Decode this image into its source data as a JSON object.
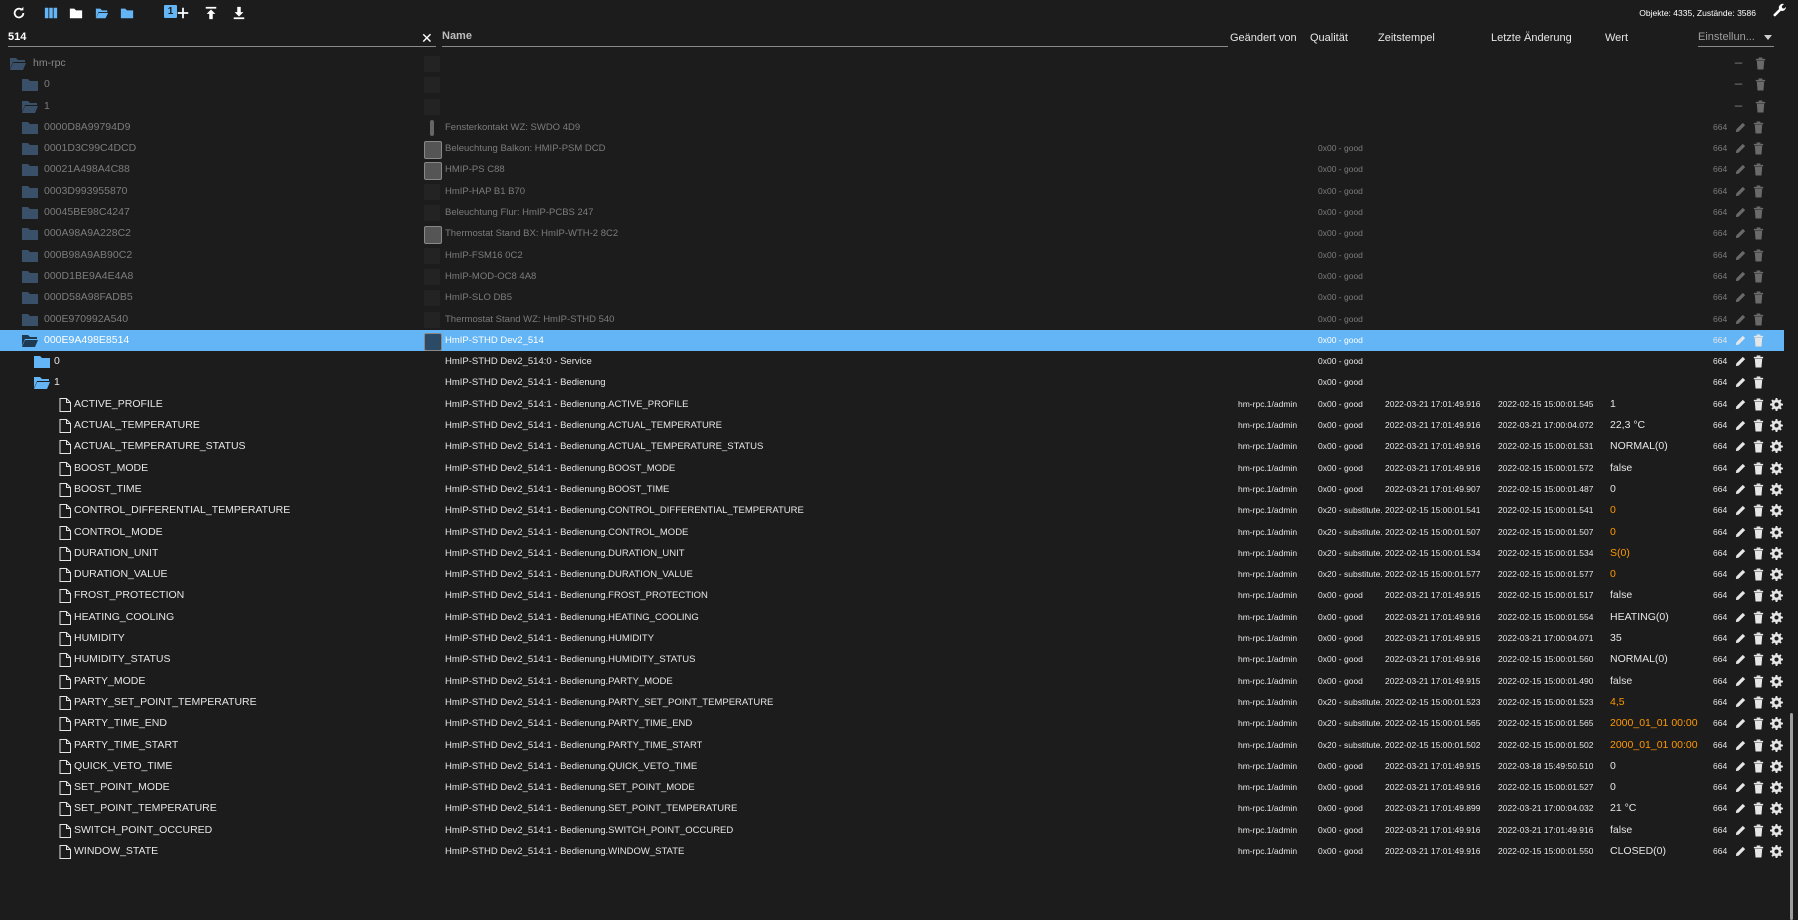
{
  "toolbar": {
    "stats": "Objekte: 4335, Zustände: 3586",
    "num_badge": "1",
    "buttons": [
      "refresh-icon",
      "columns-icon",
      "folder-icon",
      "folder-open-icon",
      "folder-closed-icon",
      "number-badge",
      "add-icon",
      "upload-icon",
      "download-icon"
    ]
  },
  "filter": {
    "id_value": "514",
    "name_placeholder": "Name"
  },
  "columns": {
    "changed_by": "Geändert von",
    "quality": "Qualität",
    "timestamp": "Zeitstempel",
    "last_change": "Letzte Änderung",
    "value": "Wert",
    "settings": "Einstellun..."
  },
  "colors": {
    "accent": "#64b5f6",
    "orange": "#ff9800",
    "bg": "#1c1c1c"
  },
  "rows": [
    {
      "id": "hm-rpc",
      "name": "",
      "ack": "",
      "quality": "",
      "ts": "",
      "lc": "",
      "value": "",
      "role": "",
      "level": 0,
      "type": "folder-open",
      "style": "dim2",
      "actions": "minus-trash"
    },
    {
      "id": "0",
      "name": "",
      "ack": "",
      "quality": "",
      "ts": "",
      "lc": "",
      "value": "",
      "role": "",
      "level": 1,
      "type": "folder",
      "style": "dim",
      "actions": "minus-trash"
    },
    {
      "id": "1",
      "name": "",
      "ack": "",
      "quality": "",
      "ts": "",
      "lc": "",
      "value": "",
      "role": "",
      "level": 1,
      "type": "folder-open",
      "style": "dim",
      "actions": "minus-trash"
    },
    {
      "id": "0000D8A99794D9",
      "name": "Fensterkontakt WZ: SWDO 4D9",
      "ack": "",
      "quality": "",
      "ts": "",
      "lc": "",
      "value": "",
      "role": "664",
      "level": 2,
      "type": "folder",
      "style": "dim",
      "actions": "edit-trash",
      "icon": "bar"
    },
    {
      "id": "0001D3C99C4DCD",
      "name": "Beleuchtung Balkon: HMIP-PSM DCD",
      "ack": "",
      "quality": "0x00 - good",
      "ts": "",
      "lc": "",
      "value": "",
      "role": "664",
      "level": 2,
      "type": "folder",
      "style": "dim",
      "actions": "edit-trash",
      "icon": "device"
    },
    {
      "id": "00021A498A4C88",
      "name": "HMIP-PS C88",
      "ack": "",
      "quality": "0x00 - good",
      "ts": "",
      "lc": "",
      "value": "",
      "role": "664",
      "level": 2,
      "type": "folder",
      "style": "dim",
      "actions": "edit-trash",
      "icon": "device"
    },
    {
      "id": "0003D993955870",
      "name": "HmIP-HAP B1 B70",
      "ack": "",
      "quality": "0x00 - good",
      "ts": "",
      "lc": "",
      "value": "",
      "role": "664",
      "level": 2,
      "type": "folder",
      "style": "dim",
      "actions": "edit-trash",
      "icon": ""
    },
    {
      "id": "00045BE98C4247",
      "name": "Beleuchtung Flur: HmIP-PCBS 247",
      "ack": "",
      "quality": "0x00 - good",
      "ts": "",
      "lc": "",
      "value": "",
      "role": "664",
      "level": 2,
      "type": "folder",
      "style": "dim",
      "actions": "edit-trash",
      "icon": ""
    },
    {
      "id": "000A98A9A228C2",
      "name": "Thermostat Stand BX: HmIP-WTH-2 8C2",
      "ack": "",
      "quality": "0x00 - good",
      "ts": "",
      "lc": "",
      "value": "",
      "role": "664",
      "level": 2,
      "type": "folder",
      "style": "dim",
      "actions": "edit-trash",
      "icon": "device"
    },
    {
      "id": "000B98A9AB90C2",
      "name": "HmIP-FSM16 0C2",
      "ack": "",
      "quality": "0x00 - good",
      "ts": "",
      "lc": "",
      "value": "",
      "role": "664",
      "level": 2,
      "type": "folder",
      "style": "dim",
      "actions": "edit-trash",
      "icon": ""
    },
    {
      "id": "000D1BE9A4E4A8",
      "name": "HmIP-MOD-OC8 4A8",
      "ack": "",
      "quality": "0x00 - good",
      "ts": "",
      "lc": "",
      "value": "",
      "role": "664",
      "level": 2,
      "type": "folder",
      "style": "dim",
      "actions": "edit-trash",
      "icon": ""
    },
    {
      "id": "000D58A98FADB5",
      "name": "HmIP-SLO DB5",
      "ack": "",
      "quality": "0x00 - good",
      "ts": "",
      "lc": "",
      "value": "",
      "role": "664",
      "level": 2,
      "type": "folder",
      "style": "dim",
      "actions": "edit-trash",
      "icon": ""
    },
    {
      "id": "000E970992A540",
      "name": "Thermostat Stand WZ: HmIP-STHD 540",
      "ack": "",
      "quality": "0x00 - good",
      "ts": "",
      "lc": "",
      "value": "",
      "role": "664",
      "level": 2,
      "type": "folder",
      "style": "dim",
      "actions": "edit-trash",
      "icon": ""
    },
    {
      "id": "000E9A498E8514",
      "name": "HmIP-STHD Dev2_514",
      "ack": "",
      "quality": "0x00 - good",
      "ts": "",
      "lc": "",
      "value": "",
      "role": "664",
      "level": 2,
      "type": "folder-open",
      "style": "sel",
      "actions": "edit-trash",
      "icon": "device"
    },
    {
      "id": "0",
      "name": "HmIP-STHD Dev2_514:0 - Service",
      "ack": "",
      "quality": "0x00 - good",
      "ts": "",
      "lc": "",
      "value": "",
      "role": "664",
      "level": 3,
      "type": "folder",
      "style": "",
      "actions": "edit-trash"
    },
    {
      "id": "1",
      "name": "HmIP-STHD Dev2_514:1 - Bedienung",
      "ack": "",
      "quality": "0x00 - good",
      "ts": "",
      "lc": "",
      "value": "",
      "role": "664",
      "level": 3,
      "type": "folder-open",
      "style": "",
      "actions": "edit-trash"
    },
    {
      "id": "ACTIVE_PROFILE",
      "name": "HmIP-STHD Dev2_514:1 - Bedienung.ACTIVE_PROFILE",
      "ack": "hm-rpc.1/admin",
      "quality": "0x00 - good",
      "ts": "2022-03-21 17:01:49.916",
      "lc": "2022-02-15 15:00:01.545",
      "value": "1",
      "vstyle": "",
      "role": "664",
      "level": 4,
      "type": "file",
      "style": "",
      "actions": "edit-trash-gear"
    },
    {
      "id": "ACTUAL_TEMPERATURE",
      "name": "HmIP-STHD Dev2_514:1 - Bedienung.ACTUAL_TEMPERATURE",
      "ack": "hm-rpc.1/admin",
      "quality": "0x00 - good",
      "ts": "2022-03-21 17:01:49.916",
      "lc": "2022-03-21 17:00:04.072",
      "value": "22,3 °C",
      "vstyle": "",
      "role": "664",
      "level": 4,
      "type": "file",
      "style": "",
      "actions": "edit-trash-gear"
    },
    {
      "id": "ACTUAL_TEMPERATURE_STATUS",
      "name": "HmIP-STHD Dev2_514:1 - Bedienung.ACTUAL_TEMPERATURE_STATUS",
      "ack": "hm-rpc.1/admin",
      "quality": "0x00 - good",
      "ts": "2022-03-21 17:01:49.916",
      "lc": "2022-02-15 15:00:01.531",
      "value": "NORMAL(0)",
      "vstyle": "",
      "role": "664",
      "level": 4,
      "type": "file",
      "style": "",
      "actions": "edit-trash-gear"
    },
    {
      "id": "BOOST_MODE",
      "name": "HmIP-STHD Dev2_514:1 - Bedienung.BOOST_MODE",
      "ack": "hm-rpc.1/admin",
      "quality": "0x00 - good",
      "ts": "2022-03-21 17:01:49.916",
      "lc": "2022-02-15 15:00:01.572",
      "value": "false",
      "vstyle": "",
      "role": "664",
      "level": 4,
      "type": "file",
      "style": "",
      "actions": "edit-trash-gear"
    },
    {
      "id": "BOOST_TIME",
      "name": "HmIP-STHD Dev2_514:1 - Bedienung.BOOST_TIME",
      "ack": "hm-rpc.1/admin",
      "quality": "0x00 - good",
      "ts": "2022-03-21 17:01:49.907",
      "lc": "2022-02-15 15:00:01.487",
      "value": "0",
      "vstyle": "",
      "role": "664",
      "level": 4,
      "type": "file",
      "style": "",
      "actions": "edit-trash-gear"
    },
    {
      "id": "CONTROL_DIFFERENTIAL_TEMPERATURE",
      "name": "HmIP-STHD Dev2_514:1 - Bedienung.CONTROL_DIFFERENTIAL_TEMPERATURE",
      "ack": "hm-rpc.1/admin",
      "quality": "0x20 - substitute...",
      "ts": "2022-02-15 15:00:01.541",
      "lc": "2022-02-15 15:00:01.541",
      "value": "0",
      "vstyle": "orange",
      "role": "664",
      "level": 4,
      "type": "file",
      "style": "",
      "actions": "edit-trash-gear"
    },
    {
      "id": "CONTROL_MODE",
      "name": "HmIP-STHD Dev2_514:1 - Bedienung.CONTROL_MODE",
      "ack": "hm-rpc.1/admin",
      "quality": "0x20 - substitute...",
      "ts": "2022-02-15 15:00:01.507",
      "lc": "2022-02-15 15:00:01.507",
      "value": "0",
      "vstyle": "orange",
      "role": "664",
      "level": 4,
      "type": "file",
      "style": "",
      "actions": "edit-trash-gear"
    },
    {
      "id": "DURATION_UNIT",
      "name": "HmIP-STHD Dev2_514:1 - Bedienung.DURATION_UNIT",
      "ack": "hm-rpc.1/admin",
      "quality": "0x20 - substitute...",
      "ts": "2022-02-15 15:00:01.534",
      "lc": "2022-02-15 15:00:01.534",
      "value": "S(0)",
      "vstyle": "orange",
      "role": "664",
      "level": 4,
      "type": "file",
      "style": "",
      "actions": "edit-trash-gear"
    },
    {
      "id": "DURATION_VALUE",
      "name": "HmIP-STHD Dev2_514:1 - Bedienung.DURATION_VALUE",
      "ack": "hm-rpc.1/admin",
      "quality": "0x20 - substitute...",
      "ts": "2022-02-15 15:00:01.577",
      "lc": "2022-02-15 15:00:01.577",
      "value": "0",
      "vstyle": "orange",
      "role": "664",
      "level": 4,
      "type": "file",
      "style": "",
      "actions": "edit-trash-gear"
    },
    {
      "id": "FROST_PROTECTION",
      "name": "HmIP-STHD Dev2_514:1 - Bedienung.FROST_PROTECTION",
      "ack": "hm-rpc.1/admin",
      "quality": "0x00 - good",
      "ts": "2022-03-21 17:01:49.915",
      "lc": "2022-02-15 15:00:01.517",
      "value": "false",
      "vstyle": "",
      "role": "664",
      "level": 4,
      "type": "file",
      "style": "",
      "actions": "edit-trash-gear"
    },
    {
      "id": "HEATING_COOLING",
      "name": "HmIP-STHD Dev2_514:1 - Bedienung.HEATING_COOLING",
      "ack": "hm-rpc.1/admin",
      "quality": "0x00 - good",
      "ts": "2022-03-21 17:01:49.916",
      "lc": "2022-02-15 15:00:01.554",
      "value": "HEATING(0)",
      "vstyle": "",
      "role": "664",
      "level": 4,
      "type": "file",
      "style": "",
      "actions": "edit-trash-gear"
    },
    {
      "id": "HUMIDITY",
      "name": "HmIP-STHD Dev2_514:1 - Bedienung.HUMIDITY",
      "ack": "hm-rpc.1/admin",
      "quality": "0x00 - good",
      "ts": "2022-03-21 17:01:49.915",
      "lc": "2022-03-21 17:00:04.071",
      "value": "35",
      "vstyle": "",
      "role": "664",
      "level": 4,
      "type": "file",
      "style": "",
      "actions": "edit-trash-gear"
    },
    {
      "id": "HUMIDITY_STATUS",
      "name": "HmIP-STHD Dev2_514:1 - Bedienung.HUMIDITY_STATUS",
      "ack": "hm-rpc.1/admin",
      "quality": "0x00 - good",
      "ts": "2022-03-21 17:01:49.916",
      "lc": "2022-02-15 15:00:01.560",
      "value": "NORMAL(0)",
      "vstyle": "",
      "role": "664",
      "level": 4,
      "type": "file",
      "style": "",
      "actions": "edit-trash-gear"
    },
    {
      "id": "PARTY_MODE",
      "name": "HmIP-STHD Dev2_514:1 - Bedienung.PARTY_MODE",
      "ack": "hm-rpc.1/admin",
      "quality": "0x00 - good",
      "ts": "2022-03-21 17:01:49.915",
      "lc": "2022-02-15 15:00:01.490",
      "value": "false",
      "vstyle": "",
      "role": "664",
      "level": 4,
      "type": "file",
      "style": "",
      "actions": "edit-trash-gear"
    },
    {
      "id": "PARTY_SET_POINT_TEMPERATURE",
      "name": "HmIP-STHD Dev2_514:1 - Bedienung.PARTY_SET_POINT_TEMPERATURE",
      "ack": "hm-rpc.1/admin",
      "quality": "0x20 - substitute...",
      "ts": "2022-02-15 15:00:01.523",
      "lc": "2022-02-15 15:00:01.523",
      "value": "4,5",
      "vstyle": "orange",
      "role": "664",
      "level": 4,
      "type": "file",
      "style": "",
      "actions": "edit-trash-gear"
    },
    {
      "id": "PARTY_TIME_END",
      "name": "HmIP-STHD Dev2_514:1 - Bedienung.PARTY_TIME_END",
      "ack": "hm-rpc.1/admin",
      "quality": "0x20 - substitute...",
      "ts": "2022-02-15 15:00:01.565",
      "lc": "2022-02-15 15:00:01.565",
      "value": "2000_01_01 00:00",
      "vstyle": "orange",
      "role": "664",
      "level": 4,
      "type": "file",
      "style": "",
      "actions": "edit-trash-gear"
    },
    {
      "id": "PARTY_TIME_START",
      "name": "HmIP-STHD Dev2_514:1 - Bedienung.PARTY_TIME_START",
      "ack": "hm-rpc.1/admin",
      "quality": "0x20 - substitute...",
      "ts": "2022-02-15 15:00:01.502",
      "lc": "2022-02-15 15:00:01.502",
      "value": "2000_01_01 00:00",
      "vstyle": "orange",
      "role": "664",
      "level": 4,
      "type": "file",
      "style": "",
      "actions": "edit-trash-gear"
    },
    {
      "id": "QUICK_VETO_TIME",
      "name": "HmIP-STHD Dev2_514:1 - Bedienung.QUICK_VETO_TIME",
      "ack": "hm-rpc.1/admin",
      "quality": "0x00 - good",
      "ts": "2022-03-21 17:01:49.915",
      "lc": "2022-03-18 15:49:50.510",
      "value": "0",
      "vstyle": "",
      "role": "664",
      "level": 4,
      "type": "file",
      "style": "",
      "actions": "edit-trash-gear"
    },
    {
      "id": "SET_POINT_MODE",
      "name": "HmIP-STHD Dev2_514:1 - Bedienung.SET_POINT_MODE",
      "ack": "hm-rpc.1/admin",
      "quality": "0x00 - good",
      "ts": "2022-03-21 17:01:49.916",
      "lc": "2022-02-15 15:00:01.527",
      "value": "0",
      "vstyle": "",
      "role": "664",
      "level": 4,
      "type": "file",
      "style": "",
      "actions": "edit-trash-gear"
    },
    {
      "id": "SET_POINT_TEMPERATURE",
      "name": "HmIP-STHD Dev2_514:1 - Bedienung.SET_POINT_TEMPERATURE",
      "ack": "hm-rpc.1/admin",
      "quality": "0x00 - good",
      "ts": "2022-03-21 17:01:49.899",
      "lc": "2022-03-21 17:00:04.032",
      "value": "21 °C",
      "vstyle": "",
      "role": "664",
      "level": 4,
      "type": "file",
      "style": "",
      "actions": "edit-trash-gear"
    },
    {
      "id": "SWITCH_POINT_OCCURED",
      "name": "HmIP-STHD Dev2_514:1 - Bedienung.SWITCH_POINT_OCCURED",
      "ack": "hm-rpc.1/admin",
      "quality": "0x00 - good",
      "ts": "2022-03-21 17:01:49.916",
      "lc": "2022-03-21 17:01:49.916",
      "value": "false",
      "vstyle": "",
      "role": "664",
      "level": 4,
      "type": "file",
      "style": "",
      "actions": "edit-trash-gear"
    },
    {
      "id": "WINDOW_STATE",
      "name": "HmIP-STHD Dev2_514:1 - Bedienung.WINDOW_STATE",
      "ack": "hm-rpc.1/admin",
      "quality": "0x00 - good",
      "ts": "2022-03-21 17:01:49.916",
      "lc": "2022-02-15 15:00:01.550",
      "value": "CLOSED(0)",
      "vstyle": "",
      "role": "664",
      "level": 4,
      "type": "file",
      "style": "",
      "actions": "edit-trash-gear"
    }
  ]
}
